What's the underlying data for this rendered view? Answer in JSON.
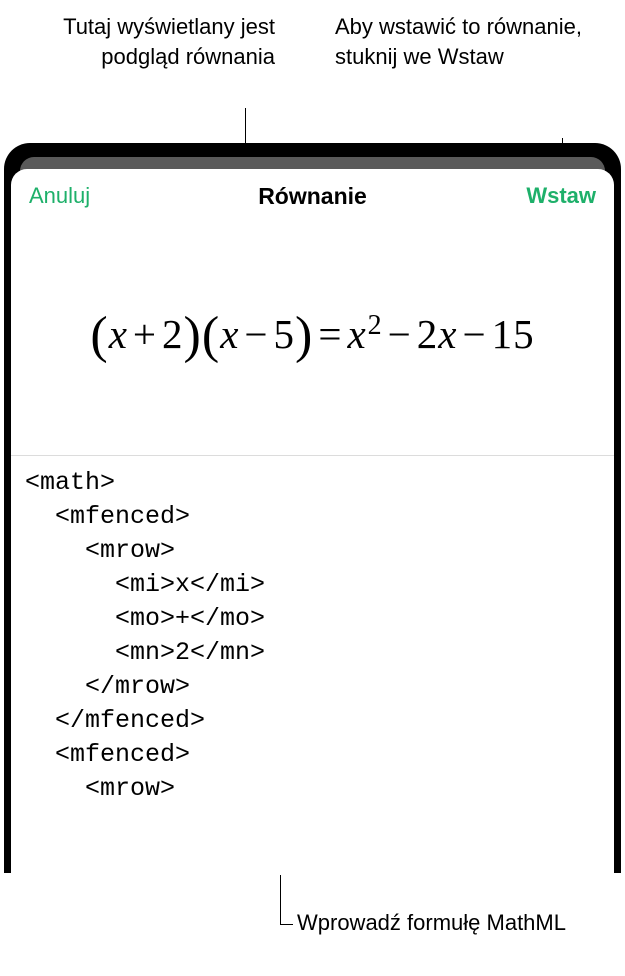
{
  "callouts": {
    "preview": "Tutaj wyświetlany jest podgląd równania",
    "insert": "Aby wstawić to równanie, stuknij we Wstaw",
    "formula": "Wprowadź formułę MathML"
  },
  "sheet": {
    "title": "Równanie",
    "cancel": "Anuluj",
    "insert": "Wstaw"
  },
  "equation": {
    "lparen1": "(",
    "var1": "x",
    "op1": "+",
    "num1": "2",
    "rparen1": ")",
    "lparen2": "(",
    "var2": "x",
    "op2": "−",
    "num2": "5",
    "rparen2": ")",
    "eq": "=",
    "var3": "x",
    "sup": "2",
    "op3": "−",
    "num3": "2",
    "var4": "x",
    "op4": "−",
    "num4": "15"
  },
  "code": "<math>\n  <mfenced>\n    <mrow>\n      <mi>x</mi>\n      <mo>+</mo>\n      <mn>2</mn>\n    </mrow>\n  </mfenced>\n  <mfenced>\n    <mrow>"
}
